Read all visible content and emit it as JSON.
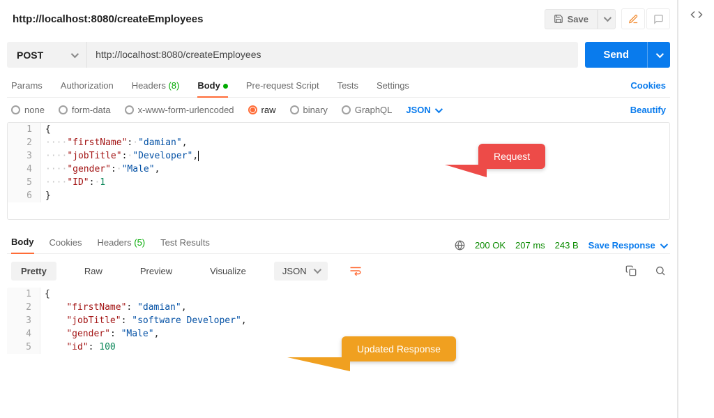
{
  "header": {
    "title": "http://localhost:8080/createEmployees",
    "save": "Save"
  },
  "request": {
    "method": "POST",
    "url": "http://localhost:8080/createEmployees",
    "send": "Send"
  },
  "tabs": {
    "params": "Params",
    "auth": "Authorization",
    "headers": "Headers",
    "headers_count": "(8)",
    "body": "Body",
    "preReq": "Pre-request Script",
    "tests": "Tests",
    "settings": "Settings",
    "cookies": "Cookies"
  },
  "bodyTypes": {
    "none": "none",
    "formdata": "form-data",
    "urlenc": "x-www-form-urlencoded",
    "raw": "raw",
    "binary": "binary",
    "graphql": "GraphQL",
    "format": "JSON",
    "beautify": "Beautify"
  },
  "requestBody": [
    {
      "ln": "1",
      "html": "|"
    },
    {
      "ln": "2",
      "html": "····\"firstName\":·\"damian\","
    },
    {
      "ln": "3",
      "html": "····\"jobTitle\":·\"Developer\","
    },
    {
      "ln": "4",
      "html": "····\"gender\":·\"Male\","
    },
    {
      "ln": "5",
      "html": "····\"ID\":·1"
    },
    {
      "ln": "6",
      "html": "}"
    }
  ],
  "reqJson": {
    "line1": "{",
    "k1": "\"firstName\"",
    "v1": "\"damian\"",
    "k2": "\"jobTitle\"",
    "v2": "\"Developer\"",
    "k3": "\"gender\"",
    "v3": "\"Male\"",
    "k4": "\"ID\"",
    "v4": "1",
    "line6": "}"
  },
  "response": {
    "tabs": {
      "body": "Body",
      "cookies": "Cookies",
      "headers": "Headers",
      "headers_count": "(5)",
      "tests": "Test Results"
    },
    "status": {
      "code": "200 OK",
      "time": "207 ms",
      "size": "243 B",
      "save": "Save Response"
    },
    "toolbar": {
      "pretty": "Pretty",
      "raw": "Raw",
      "preview": "Preview",
      "visual": "Visualize",
      "format": "JSON"
    }
  },
  "respJson": {
    "line1": "{",
    "k1": "\"firstName\"",
    "v1": "\"damian\"",
    "k2": "\"jobTitle\"",
    "v2": "\"software Developer\"",
    "k3": "\"gender\"",
    "v3": "\"Male\"",
    "k4": "\"id\"",
    "v4": "100"
  },
  "callouts": {
    "request": "Request",
    "response": "Updated Response"
  }
}
